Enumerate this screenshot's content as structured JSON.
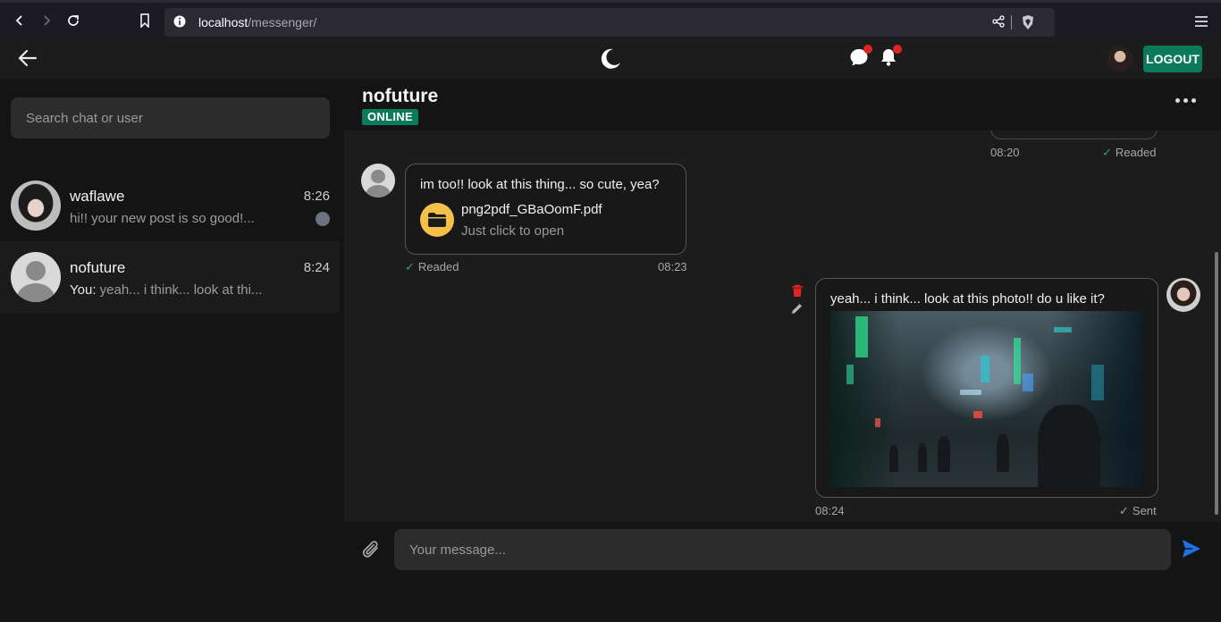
{
  "browser": {
    "url_host": "localhost",
    "url_path": "/messenger/"
  },
  "header": {
    "logout_label": "LOGOUT",
    "icons": [
      "back-arrow-icon",
      "moon-icon",
      "chat-icon",
      "bell-icon"
    ],
    "notification_color": "#e02424",
    "accent_color": "#0b7a5a"
  },
  "sidebar": {
    "search_placeholder": "Search chat or user",
    "chats": [
      {
        "name": "waflawe",
        "time": "8:26",
        "preview": "hi!! your new post is so good!...",
        "you_prefix": ""
      },
      {
        "name": "nofuture",
        "time": "8:24",
        "preview": "yeah... i think... look at thi...",
        "you_prefix": "You:"
      }
    ]
  },
  "conversation": {
    "peer_name": "nofuture",
    "peer_status": "ONLINE",
    "previous": {
      "time": "08:20",
      "status": "Readed"
    },
    "messages": [
      {
        "text": "im too!! look at this thing... so cute, yea?",
        "file_name": "png2pdf_GBaOomF.pdf",
        "file_hint": "Just click to open",
        "status": "Readed",
        "time": "08:23"
      },
      {
        "text": "yeah... i think... look at this photo!! do u like it?",
        "time": "08:24",
        "status": "Sent"
      }
    ]
  },
  "composer": {
    "placeholder": "Your message..."
  }
}
